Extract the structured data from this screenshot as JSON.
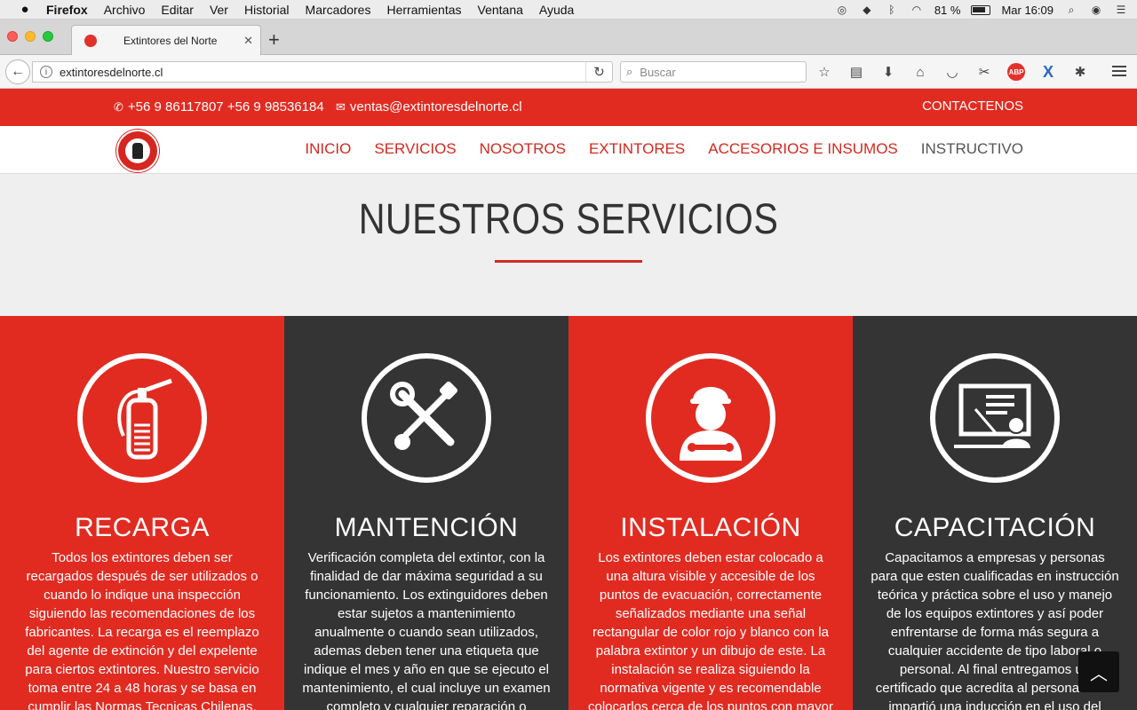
{
  "mac_menu": {
    "app": "Firefox",
    "items": [
      "Archivo",
      "Editar",
      "Ver",
      "Historial",
      "Marcadores",
      "Herramientas",
      "Ventana",
      "Ayuda"
    ],
    "battery": "81 %",
    "clock": "Mar 16:09"
  },
  "browser": {
    "tab_title": "Extintores del Norte",
    "url": "extintoresdelnorte.cl",
    "search_placeholder": "Buscar"
  },
  "site": {
    "topbar": {
      "phones": "+56 9 86117807 +56 9 98536184",
      "email": "ventas@extintoresdelnorte.cl",
      "contact": "CONTACTENOS"
    },
    "nav": [
      "INICIO",
      "SERVICIOS",
      "NOSOTROS",
      "EXTINTORES",
      "ACCESORIOS E INSUMOS",
      "INSTRUCTIVO"
    ],
    "hero_title": "NUESTROS SERVICIOS",
    "services": [
      {
        "title": "RECARGA",
        "icon": "extinguisher-icon",
        "text": "Todos los extintores deben ser recargados después de ser utilizados o cuando lo indique una inspección siguiendo las recomendaciones de los fabricantes. La recarga es el reemplazo del agente de extinción y del expelente para ciertos extintores. Nuestro servicio toma entre 24 a 48 horas y se basa en cumplir las Normas Tecnicas Chilenas."
      },
      {
        "title": "MANTENCIÓN",
        "icon": "tools-icon",
        "text": "Verificación completa del extintor, con la finalidad de dar máxima seguridad a su funcionamiento. Los extinguidores deben estar sujetos a mantenimiento anualmente o cuando sean utilizados, ademas deben tener una etiqueta que indique el mes y año en que se ejecuto el mantenimiento, el cual incluye un examen completo y cualquier reparación o repuesto que necesite."
      },
      {
        "title": "INSTALACIÓN",
        "icon": "technician-icon",
        "text": "Los extintores deben estar colocado a una altura visible y accesible de los puntos de evacuación, correctamente señalizados mediante una señal rectangular de color rojo y blanco con la palabra extintor y un dibujo de este. La instalación se realiza siguiendo la normativa vigente y es recomendable colocarlos cerca de los puntos con mayor probabilidades de inicio de fuego."
      },
      {
        "title": "CAPACITACIÓN",
        "icon": "presentation-icon",
        "text": "Capacitamos a empresas y personas para que esten cualificadas en instrucción teórica y práctica sobre el uso y manejo de los equipos extintores y así poder enfrentarse de forma más segura a cualquier accidente de tipo laboral o personal. Al final entregamos un certificado que acredita al personal se le impartió una inducción en el uso del extintor."
      }
    ]
  },
  "colors": {
    "brand_red": "#e12b21",
    "dark": "#343434",
    "hero_bg": "#efefef"
  }
}
